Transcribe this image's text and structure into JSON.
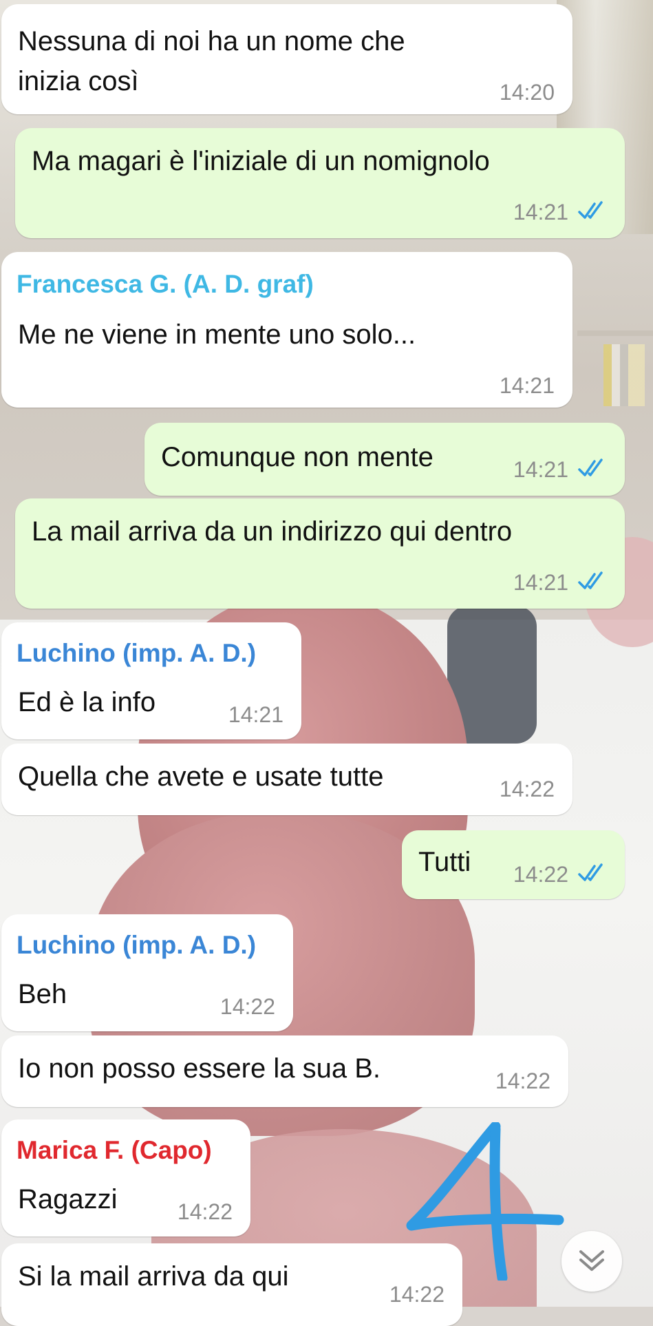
{
  "messages": [
    {
      "text_lines": [
        "Nessuna di noi ha un nome che",
        "inizia così"
      ],
      "time": "14:20"
    },
    {
      "text": "Ma magari è l'iniziale di un nomignolo",
      "time": "14:21"
    },
    {
      "sender": "Francesca G. (A. D. graf)",
      "text": "Me ne viene in mente uno solo...",
      "time": "14:21"
    },
    {
      "text": "Comunque non mente",
      "time": "14:21"
    },
    {
      "text": "La mail arriva da un indirizzo qui dentro",
      "time": "14:21"
    },
    {
      "sender": "Luchino (imp. A. D.)",
      "text": "Ed è la info",
      "time": "14:21"
    },
    {
      "text": "Quella che avete e  usate tutte",
      "time": "14:22"
    },
    {
      "text": "Tutti",
      "time": "14:22"
    },
    {
      "sender": "Luchino (imp. A. D.)",
      "text": "Beh",
      "time": "14:22"
    },
    {
      "text": "Io non posso essere la sua B.",
      "time": "14:22"
    },
    {
      "sender": "Marica F. (Capo)",
      "text": "Ragazzi",
      "time": "14:22"
    },
    {
      "text": "Si la mail arriva da qui",
      "time": "14:22"
    }
  ],
  "annotation": {
    "text": "4",
    "color": "#2f9be3"
  },
  "colors": {
    "incoming_bubble": "#ffffff",
    "outgoing_bubble": "#e7fcd7",
    "read_ticks": "#2f9be3",
    "sender_francesca": "#3fb8e4",
    "sender_luchino": "#3a86d6",
    "sender_marica": "#e0282e"
  },
  "icons": {
    "read_receipt": "double-check-icon",
    "scroll_down": "chevron-double-down-icon"
  }
}
